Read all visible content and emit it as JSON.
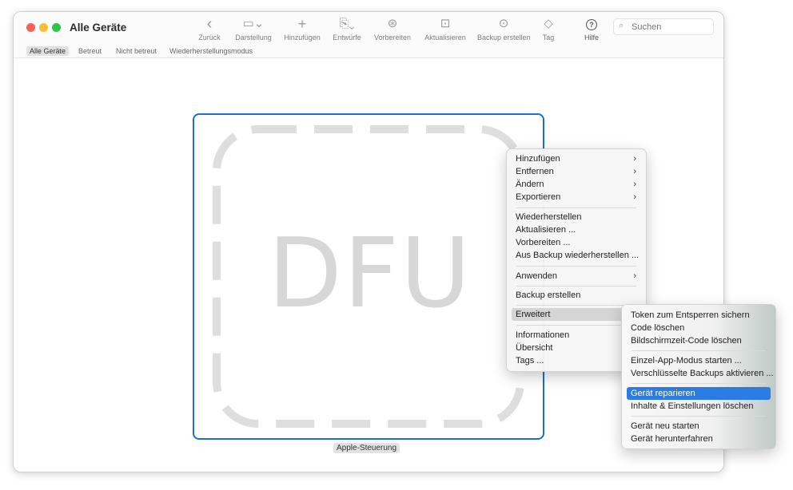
{
  "window": {
    "title": "Alle Geräte"
  },
  "toolbar": {
    "items": [
      {
        "label": "Zurück",
        "icon": "chevron-left-icon",
        "glyph": "‹"
      },
      {
        "label": "Darstellung",
        "icon": "view-icon",
        "glyph": "▭⌄"
      },
      {
        "label": "Hinzufügen",
        "icon": "plus-icon",
        "glyph": "+"
      },
      {
        "label": "Entwürfe",
        "icon": "blueprint-icon",
        "glyph": "⎘⌄"
      },
      {
        "label": "Vorbereiten",
        "icon": "prepare-icon",
        "glyph": "⊛"
      },
      {
        "label": "Aktualisieren",
        "icon": "update-icon",
        "glyph": "⊡"
      },
      {
        "label": "Backup erstellen",
        "icon": "backup-icon",
        "glyph": "⊙"
      },
      {
        "label": "Tag",
        "icon": "tag-icon",
        "glyph": "◇"
      },
      {
        "label": "Hilfe",
        "icon": "help-icon",
        "glyph": "?"
      }
    ],
    "search_placeholder": "Suchen"
  },
  "filters": [
    "Alle Geräte",
    "Betreut",
    "Nicht betreut",
    "Wiederherstellungsmodus"
  ],
  "device": {
    "screen_text": "DFU",
    "label": "Apple-Steuerung"
  },
  "context_menu": {
    "items": [
      {
        "label": "Hinzufügen",
        "submenu": true
      },
      {
        "label": "Entfernen",
        "submenu": true
      },
      {
        "label": "Ändern",
        "submenu": true
      },
      {
        "label": "Exportieren",
        "submenu": true
      },
      {
        "label": "Wiederherstellen"
      },
      {
        "label": "Aktualisieren ..."
      },
      {
        "label": "Vorbereiten ..."
      },
      {
        "label": "Aus Backup wiederherstellen ..."
      },
      {
        "label": "Anwenden",
        "submenu": true
      },
      {
        "label": "Backup erstellen"
      },
      {
        "label": "Erweitert",
        "submenu": true,
        "highlighted": true
      },
      {
        "label": "Informationen"
      },
      {
        "label": "Übersicht"
      },
      {
        "label": "Tags ..."
      }
    ],
    "arrow": "›"
  },
  "submenu": {
    "items": [
      {
        "label": "Token zum Entsperren sichern"
      },
      {
        "label": "Code löschen"
      },
      {
        "label": "Bildschirmzeit-Code löschen"
      },
      {
        "label": "Einzel-App-Modus starten ..."
      },
      {
        "label": "Verschlüsselte Backups aktivieren ..."
      },
      {
        "label": "Gerät reparieren",
        "highlighted": true
      },
      {
        "label": "Inhalte & Einstellungen löschen"
      },
      {
        "label": "Gerät neu starten"
      },
      {
        "label": "Gerät herunterfahren"
      }
    ]
  },
  "colors": {
    "selection_blue": "#2a7be4",
    "device_border": "#1a6fd6"
  }
}
